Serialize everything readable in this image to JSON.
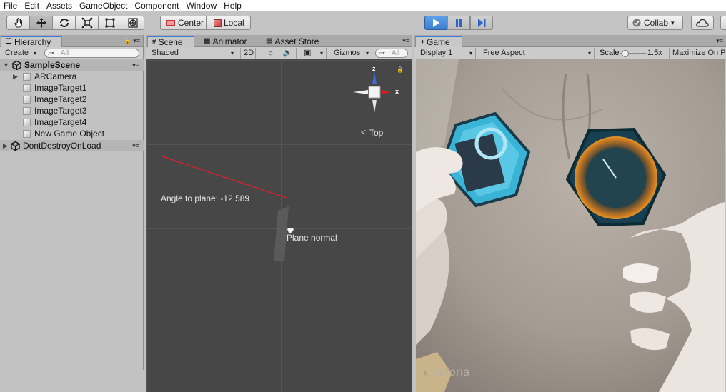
{
  "menu": [
    "File",
    "Edit",
    "Assets",
    "GameObject",
    "Component",
    "Window",
    "Help"
  ],
  "toolbar": {
    "tools": [
      "hand-tool",
      "move-tool",
      "rotate-tool",
      "scale-tool",
      "rect-tool",
      "transform-tool"
    ],
    "pivot_label": "Center",
    "space_label": "Local",
    "collab_label": "Collab",
    "collab_arrow": "▾"
  },
  "hierarchy": {
    "tab_label": "Hierarchy",
    "create_label": "Create",
    "search_placeholder": "All",
    "scene_name": "SampleScene",
    "items": [
      "ARCamera",
      "ImageTarget1",
      "ImageTarget2",
      "ImageTarget3",
      "ImageTarget4",
      "New Game Object"
    ],
    "dont_destroy": "DontDestroyOnLoad"
  },
  "scene_panel": {
    "tabs": [
      "Scene",
      "Animator",
      "Asset Store"
    ],
    "shading_mode": "Shaded",
    "mode_2d": "2D",
    "gizmos_label": "Gizmos",
    "search_placeholder": "All",
    "gizmo_axes": {
      "z": "z",
      "x": "x"
    },
    "view_label": "Top",
    "angle_text": "Angle to plane: -12.589",
    "normal_text": "Plane normal"
  },
  "game_panel": {
    "tab_label": "Game",
    "display": "Display 1",
    "aspect": "Free Aspect",
    "scale_label": "Scale",
    "scale_value": "1.5x",
    "scale_fraction": 0.15,
    "maximize_label": "Maximize On Pl",
    "watermark": "vuforia"
  },
  "colors": {
    "play_blue": "#3a7fd0",
    "axis_red": "#d81e1e",
    "axis_blue": "#3d6bd8",
    "ray_red": "#e0202a"
  }
}
